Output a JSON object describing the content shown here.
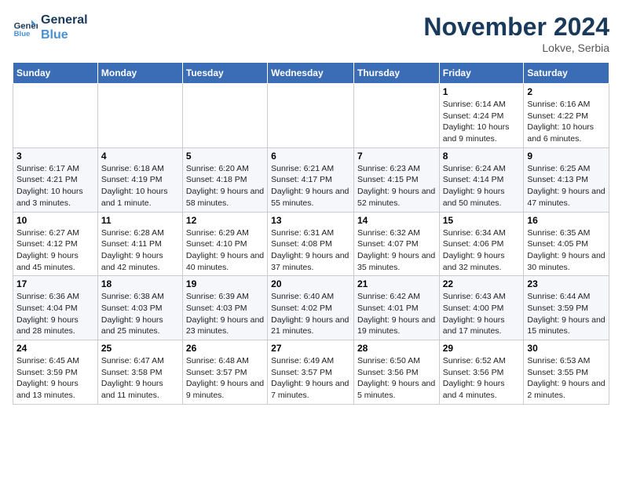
{
  "header": {
    "logo_line1": "General",
    "logo_line2": "Blue",
    "month": "November 2024",
    "location": "Lokve, Serbia"
  },
  "days_of_week": [
    "Sunday",
    "Monday",
    "Tuesday",
    "Wednesday",
    "Thursday",
    "Friday",
    "Saturday"
  ],
  "weeks": [
    [
      {
        "day": "",
        "info": ""
      },
      {
        "day": "",
        "info": ""
      },
      {
        "day": "",
        "info": ""
      },
      {
        "day": "",
        "info": ""
      },
      {
        "day": "",
        "info": ""
      },
      {
        "day": "1",
        "info": "Sunrise: 6:14 AM\nSunset: 4:24 PM\nDaylight: 10 hours and 9 minutes."
      },
      {
        "day": "2",
        "info": "Sunrise: 6:16 AM\nSunset: 4:22 PM\nDaylight: 10 hours and 6 minutes."
      }
    ],
    [
      {
        "day": "3",
        "info": "Sunrise: 6:17 AM\nSunset: 4:21 PM\nDaylight: 10 hours and 3 minutes."
      },
      {
        "day": "4",
        "info": "Sunrise: 6:18 AM\nSunset: 4:19 PM\nDaylight: 10 hours and 1 minute."
      },
      {
        "day": "5",
        "info": "Sunrise: 6:20 AM\nSunset: 4:18 PM\nDaylight: 9 hours and 58 minutes."
      },
      {
        "day": "6",
        "info": "Sunrise: 6:21 AM\nSunset: 4:17 PM\nDaylight: 9 hours and 55 minutes."
      },
      {
        "day": "7",
        "info": "Sunrise: 6:23 AM\nSunset: 4:15 PM\nDaylight: 9 hours and 52 minutes."
      },
      {
        "day": "8",
        "info": "Sunrise: 6:24 AM\nSunset: 4:14 PM\nDaylight: 9 hours and 50 minutes."
      },
      {
        "day": "9",
        "info": "Sunrise: 6:25 AM\nSunset: 4:13 PM\nDaylight: 9 hours and 47 minutes."
      }
    ],
    [
      {
        "day": "10",
        "info": "Sunrise: 6:27 AM\nSunset: 4:12 PM\nDaylight: 9 hours and 45 minutes."
      },
      {
        "day": "11",
        "info": "Sunrise: 6:28 AM\nSunset: 4:11 PM\nDaylight: 9 hours and 42 minutes."
      },
      {
        "day": "12",
        "info": "Sunrise: 6:29 AM\nSunset: 4:10 PM\nDaylight: 9 hours and 40 minutes."
      },
      {
        "day": "13",
        "info": "Sunrise: 6:31 AM\nSunset: 4:08 PM\nDaylight: 9 hours and 37 minutes."
      },
      {
        "day": "14",
        "info": "Sunrise: 6:32 AM\nSunset: 4:07 PM\nDaylight: 9 hours and 35 minutes."
      },
      {
        "day": "15",
        "info": "Sunrise: 6:34 AM\nSunset: 4:06 PM\nDaylight: 9 hours and 32 minutes."
      },
      {
        "day": "16",
        "info": "Sunrise: 6:35 AM\nSunset: 4:05 PM\nDaylight: 9 hours and 30 minutes."
      }
    ],
    [
      {
        "day": "17",
        "info": "Sunrise: 6:36 AM\nSunset: 4:04 PM\nDaylight: 9 hours and 28 minutes."
      },
      {
        "day": "18",
        "info": "Sunrise: 6:38 AM\nSunset: 4:03 PM\nDaylight: 9 hours and 25 minutes."
      },
      {
        "day": "19",
        "info": "Sunrise: 6:39 AM\nSunset: 4:03 PM\nDaylight: 9 hours and 23 minutes."
      },
      {
        "day": "20",
        "info": "Sunrise: 6:40 AM\nSunset: 4:02 PM\nDaylight: 9 hours and 21 minutes."
      },
      {
        "day": "21",
        "info": "Sunrise: 6:42 AM\nSunset: 4:01 PM\nDaylight: 9 hours and 19 minutes."
      },
      {
        "day": "22",
        "info": "Sunrise: 6:43 AM\nSunset: 4:00 PM\nDaylight: 9 hours and 17 minutes."
      },
      {
        "day": "23",
        "info": "Sunrise: 6:44 AM\nSunset: 3:59 PM\nDaylight: 9 hours and 15 minutes."
      }
    ],
    [
      {
        "day": "24",
        "info": "Sunrise: 6:45 AM\nSunset: 3:59 PM\nDaylight: 9 hours and 13 minutes."
      },
      {
        "day": "25",
        "info": "Sunrise: 6:47 AM\nSunset: 3:58 PM\nDaylight: 9 hours and 11 minutes."
      },
      {
        "day": "26",
        "info": "Sunrise: 6:48 AM\nSunset: 3:57 PM\nDaylight: 9 hours and 9 minutes."
      },
      {
        "day": "27",
        "info": "Sunrise: 6:49 AM\nSunset: 3:57 PM\nDaylight: 9 hours and 7 minutes."
      },
      {
        "day": "28",
        "info": "Sunrise: 6:50 AM\nSunset: 3:56 PM\nDaylight: 9 hours and 5 minutes."
      },
      {
        "day": "29",
        "info": "Sunrise: 6:52 AM\nSunset: 3:56 PM\nDaylight: 9 hours and 4 minutes."
      },
      {
        "day": "30",
        "info": "Sunrise: 6:53 AM\nSunset: 3:55 PM\nDaylight: 9 hours and 2 minutes."
      }
    ]
  ]
}
